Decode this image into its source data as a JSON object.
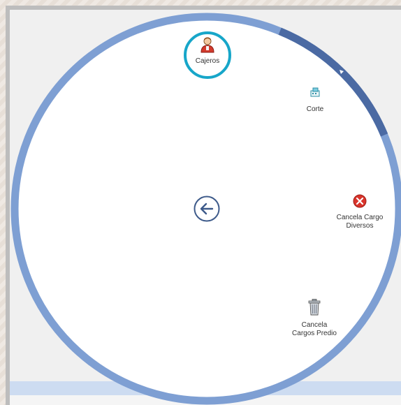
{
  "radial_menu": {
    "items": [
      {
        "id": "cajeros",
        "label": "Cajeros",
        "icon": "cashier-user-icon",
        "selected": true
      },
      {
        "id": "corte",
        "label": "Corte",
        "icon": "cash-register-icon"
      },
      {
        "id": "cancela_cargo_diversos",
        "label_line1": "Cancela Cargo",
        "label_line2": "Diversos",
        "icon": "cancel-red-x-icon"
      },
      {
        "id": "cancela_cargos_predio",
        "label_line1": "Cancela",
        "label_line2": "Cargos Predio",
        "icon": "trash-bin-icon"
      }
    ],
    "back_icon": "arrow-left-circle-icon"
  },
  "colors": {
    "ring": "#7e9fd3",
    "ring_active_segment": "#4b6aa3",
    "selection_ring": "#17a6c9",
    "back_arrow": "#3d5a8a",
    "cancel_red": "#d9342b"
  }
}
